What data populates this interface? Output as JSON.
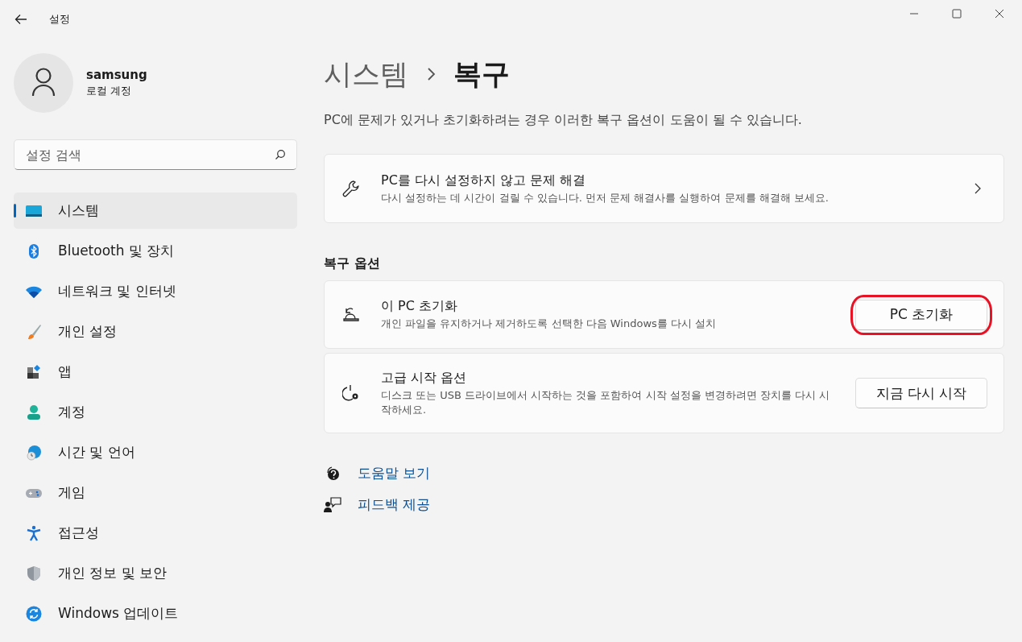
{
  "window": {
    "title": "설정"
  },
  "account": {
    "name": "samsung",
    "type": "로컬 계정"
  },
  "search": {
    "placeholder": "설정 검색"
  },
  "sidebar": {
    "items": [
      {
        "label": "시스템",
        "kind": "system",
        "selected": true
      },
      {
        "label": "Bluetooth 및 장치",
        "kind": "bluetooth",
        "selected": false
      },
      {
        "label": "네트워크 및 인터넷",
        "kind": "wifi",
        "selected": false
      },
      {
        "label": "개인 설정",
        "kind": "brush",
        "selected": false
      },
      {
        "label": "앱",
        "kind": "apps",
        "selected": false
      },
      {
        "label": "계정",
        "kind": "person",
        "selected": false
      },
      {
        "label": "시간 및 언어",
        "kind": "globe",
        "selected": false
      },
      {
        "label": "게임",
        "kind": "gamepad",
        "selected": false
      },
      {
        "label": "접근성",
        "kind": "accessibility",
        "selected": false
      },
      {
        "label": "개인 정보 및 보안",
        "kind": "shield",
        "selected": false
      },
      {
        "label": "Windows 업데이트",
        "kind": "update",
        "selected": false
      }
    ]
  },
  "breadcrumb": [
    "시스템",
    "복구"
  ],
  "description": "PC에 문제가 있거나 초기화하려는 경우 이러한 복구 옵션이 도움이 될 수 있습니다.",
  "troubleshoot": {
    "title": "PC를 다시 설정하지 않고 문제 해결",
    "subtitle": "다시 설정하는 데 시간이 걸릴 수 있습니다. 먼저 문제 해결사를 실행하여 문제를 해결해 보세요."
  },
  "recovery_options": {
    "heading": "복구 옵션",
    "items": [
      {
        "kind": "reset",
        "title": "이 PC 초기화",
        "subtitle": "개인 파일을 유지하거나 제거하도록 선택한 다음 Windows를 다시 설치",
        "button": "PC 초기화",
        "highlighted": true
      },
      {
        "kind": "power",
        "title": "고급 시작 옵션",
        "subtitle": "디스크 또는 USB 드라이브에서 시작하는 것을 포함하여 시작 설정을 변경하려면 장치를 다시 시작하세요.",
        "button": "지금 다시 시작",
        "highlighted": false
      }
    ]
  },
  "links": [
    {
      "kind": "help",
      "label": "도움말 보기"
    },
    {
      "kind": "feedback",
      "label": "피드백 제공"
    }
  ]
}
